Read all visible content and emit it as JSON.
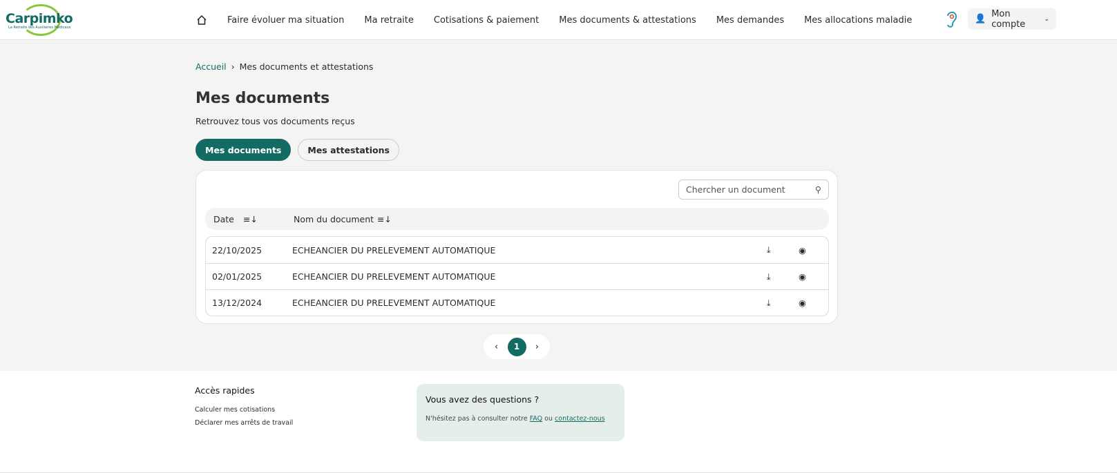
{
  "header": {
    "logo_text": "Carpimko",
    "logo_tagline": "La Retraite des Auxiliaires Médicaux",
    "nav": [
      "Faire évoluer ma situation",
      "Ma retraite",
      "Cotisations & paiement",
      "Mes documents & attestations",
      "Mes demandes",
      "Mes allocations maladie"
    ],
    "account": "Mon compte"
  },
  "breadcrumb": {
    "home": "Accueil",
    "sep": "›",
    "current": "Mes documents et attestations"
  },
  "page": {
    "title": "Mes documents",
    "subtitle": "Retrouvez tous vos documents reçus"
  },
  "tabs": [
    "Mes documents",
    "Mes attestations"
  ],
  "search": {
    "placeholder": "Chercher un document"
  },
  "table": {
    "headers": [
      "Date",
      "Nom du document"
    ],
    "rows": [
      {
        "date": "22/10/2025",
        "name": "ECHEANCIER DU PRELEVEMENT AUTOMATIQUE"
      },
      {
        "date": "02/01/2025",
        "name": "ECHEANCIER DU PRELEVEMENT AUTOMATIQUE"
      },
      {
        "date": "13/12/2024",
        "name": "ECHEANCIER DU PRELEVEMENT AUTOMATIQUE"
      }
    ]
  },
  "pagination": {
    "prev": "‹",
    "current": "1",
    "next": "›"
  },
  "footer": {
    "quick_title": "Accès rapides",
    "quick_links": [
      "Calculer mes cotisations",
      "Déclarer mes arrêts de travail"
    ],
    "questions_title": "Vous avez des questions ?",
    "questions_text": "N'hésitez pas à consulter notre",
    "faq": "FAQ",
    "or": "ou",
    "contact": "contactez-nous"
  }
}
